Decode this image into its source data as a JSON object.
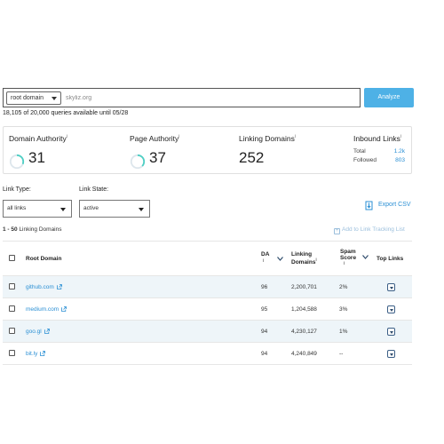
{
  "search": {
    "scope_label": "root domain",
    "query_value": "skyliz.org",
    "analyze_label": "Analyze",
    "quota_text": "18,105 of 20,000 queries available until 05/28"
  },
  "metrics": {
    "domain_authority": {
      "title": "Domain Authority",
      "value": "31",
      "ring_fraction": 0.31
    },
    "page_authority": {
      "title": "Page Authority",
      "value": "37",
      "ring_fraction": 0.37
    },
    "linking_domains": {
      "title": "Linking Domains",
      "value": "252"
    },
    "inbound_links": {
      "title": "Inbound Links",
      "total_label": "Total",
      "total_value": "1.2k",
      "followed_label": "Followed",
      "followed_value": "803"
    },
    "info_mark": "i"
  },
  "filters": {
    "link_type_label": "Link Type:",
    "link_type_value": "all links",
    "link_state_label": "Link State:",
    "link_state_value": "active"
  },
  "export_label": "Export CSV",
  "results": {
    "range_bold": "1 - 50",
    "range_text": "Linking Domains",
    "add_tracking_label": "Add to Link Tracking List"
  },
  "table": {
    "columns": {
      "root_domain": "Root Domain",
      "da": "DA",
      "linking_domains_1": "Linking",
      "linking_domains_2": "Domains",
      "spam_1": "Spam",
      "spam_2": "Score",
      "top_links": "Top Links",
      "info_mark": "i"
    },
    "rows": [
      {
        "domain": "github.com",
        "da": "96",
        "linking": "2,200,701",
        "spam": "2%"
      },
      {
        "domain": "medium.com",
        "da": "95",
        "linking": "1,204,588",
        "spam": "3%"
      },
      {
        "domain": "goo.gl",
        "da": "94",
        "linking": "4,230,127",
        "spam": "1%"
      },
      {
        "domain": "bit.ly",
        "da": "94",
        "linking": "4,240,849",
        "spam": "--"
      }
    ]
  },
  "colors": {
    "accent": "#4eb1e6",
    "link": "#2a8fd4",
    "ring": "#4ecfc4",
    "row_alt": "#eef5f9"
  }
}
